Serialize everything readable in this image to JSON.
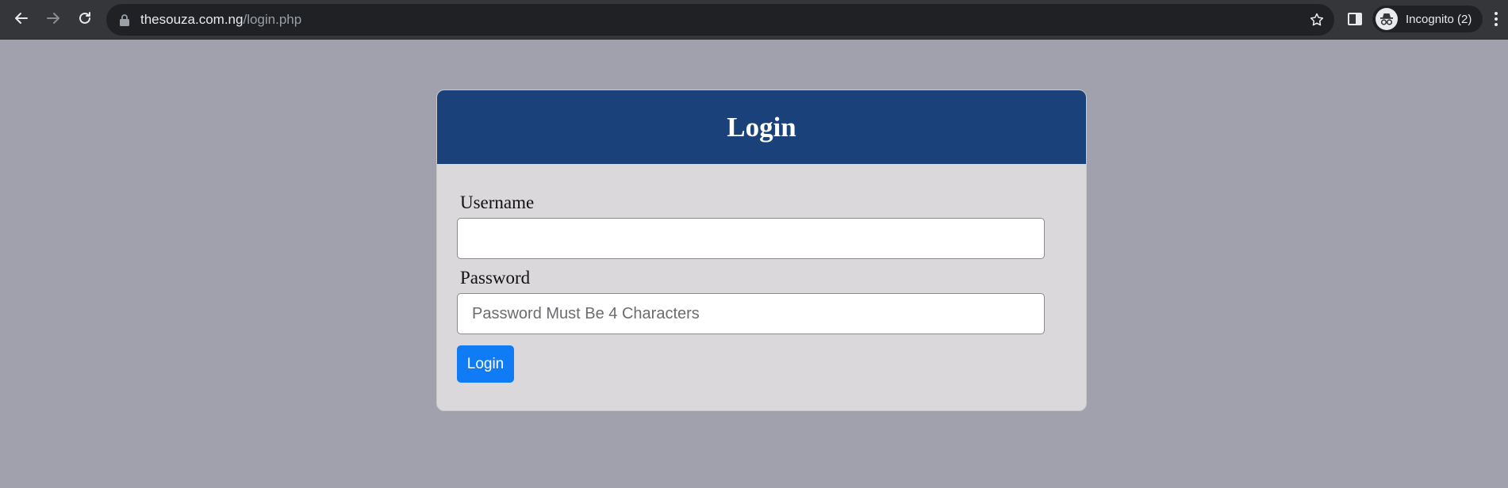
{
  "browser": {
    "url_host": "thesouza.com.ng",
    "url_path": "/login.php",
    "incognito_label": "Incognito (2)",
    "icons": {
      "back": "arrow-left-icon",
      "forward": "arrow-right-icon",
      "reload": "reload-icon",
      "lock": "lock-icon",
      "bookmark": "star-icon",
      "side_panel": "side-panel-icon",
      "incognito": "incognito-icon",
      "menu": "kebab-menu-icon"
    }
  },
  "login_form": {
    "title": "Login",
    "username_label": "Username",
    "username_value": "",
    "username_placeholder": "",
    "password_label": "Password",
    "password_value": "",
    "password_placeholder": "Password Must Be 4 Characters",
    "submit_label": "Login"
  },
  "colors": {
    "page_background": "#a0a1ad",
    "header_background": "#1b417b",
    "card_background": "#dad8da",
    "button_primary": "#0f7bf5",
    "toolbar_background": "#35363a",
    "omnibox_background": "#202124"
  }
}
